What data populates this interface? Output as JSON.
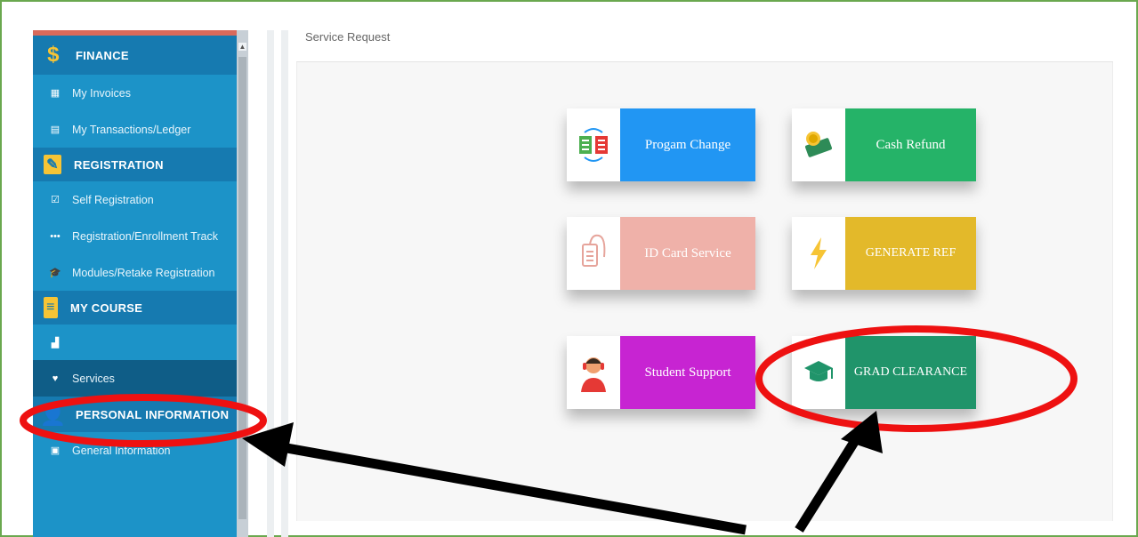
{
  "sidebar": {
    "sections": [
      {
        "title": "FINANCE",
        "icon": "dollar-icon",
        "items": [
          {
            "label": "My Invoices",
            "icon": "invoice-icon"
          },
          {
            "label": "My Transactions/Ledger",
            "icon": "ledger-icon"
          }
        ]
      },
      {
        "title": "REGISTRATION",
        "icon": "edit-icon",
        "items": [
          {
            "label": "Self Registration",
            "icon": "checkbox-icon"
          },
          {
            "label": "Registration/Enrollment Track",
            "icon": "dots-icon"
          },
          {
            "label": "Modules/Retake Registration",
            "icon": "graduation-cap-icon"
          }
        ]
      },
      {
        "title": "MY COURSE",
        "icon": "book-icon",
        "items": [
          {
            "label": "",
            "icon": "chart-icon"
          },
          {
            "label": "Services",
            "icon": "heart-icon"
          }
        ]
      },
      {
        "title": "PERSONAL INFORMATION",
        "icon": "person-icon",
        "items": [
          {
            "label": "General Information",
            "icon": "id-card-icon"
          }
        ]
      }
    ]
  },
  "main": {
    "title": "Service Request",
    "tiles": [
      {
        "label": "Progam Change",
        "icon": "program-change-icon"
      },
      {
        "label": "Cash Refund",
        "icon": "cash-icon"
      },
      {
        "label": "ID Card Service",
        "icon": "id-badge-icon"
      },
      {
        "label": "GENERATE REF",
        "icon": "lightning-icon"
      },
      {
        "label": "Student Support",
        "icon": "support-agent-icon"
      },
      {
        "label": "GRAD CLEARANCE",
        "icon": "graduation-cap-icon"
      }
    ]
  },
  "colors": {
    "sidebar": "#1c93c8",
    "section": "#167ab0",
    "accent_yellow": "#f6c435",
    "annotation_red": "#ee1111",
    "annotation_arrow": "#000000",
    "frame_green": "#6aa84f"
  }
}
